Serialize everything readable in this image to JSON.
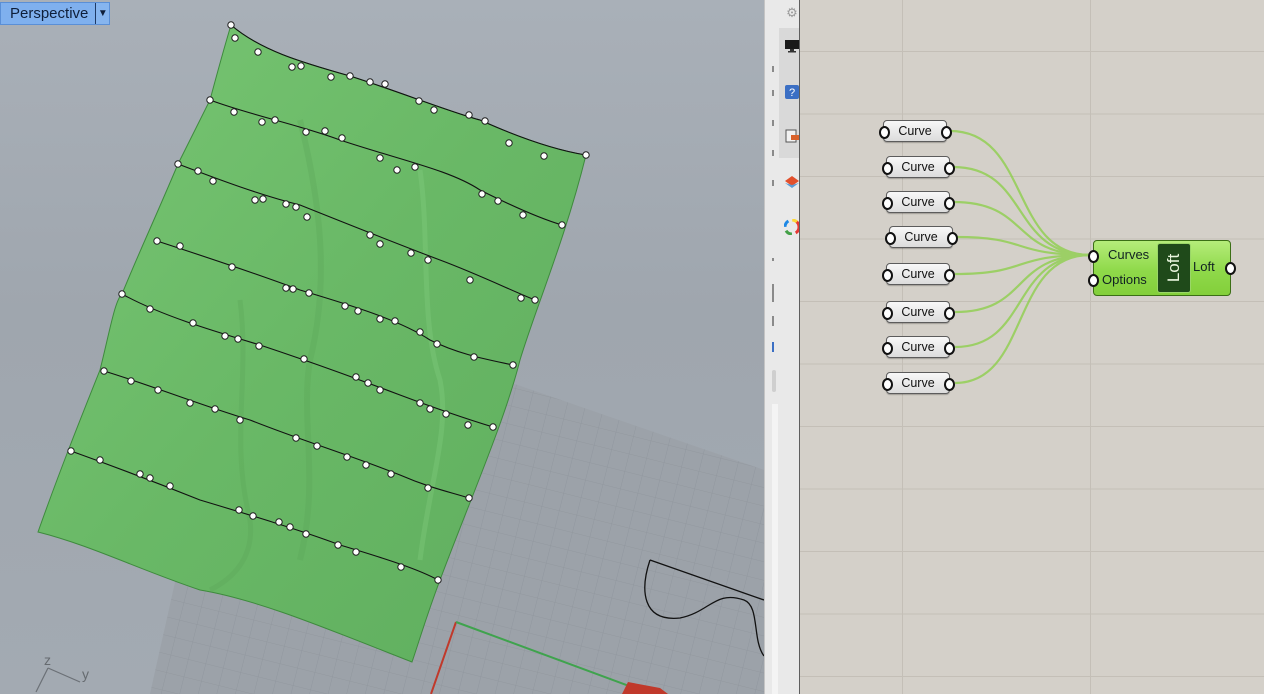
{
  "viewport": {
    "name": "Perspective",
    "axis_z": "z",
    "axis_y": "y"
  },
  "colors": {
    "surface": "#6fbf6a",
    "curve": "#1a1a1a",
    "grid": "#8d939a",
    "wire": "#8fcf4e",
    "loft_component": "#8fd94a",
    "viewport_tab": "#7fb0ee"
  },
  "grasshopper": {
    "curve_params": [
      {
        "label": "Curve"
      },
      {
        "label": "Curve"
      },
      {
        "label": "Curve"
      },
      {
        "label": "Curve"
      },
      {
        "label": "Curve"
      },
      {
        "label": "Curve"
      },
      {
        "label": "Curve"
      },
      {
        "label": "Curve"
      }
    ],
    "loft": {
      "name": "Loft",
      "inputs": [
        "Curves",
        "Options"
      ],
      "output": "Loft"
    },
    "strip_icons": [
      "gear-icon",
      "display-icon",
      "help-icon",
      "bake-icon",
      "layers-icon",
      "color-wheel-icon"
    ]
  }
}
